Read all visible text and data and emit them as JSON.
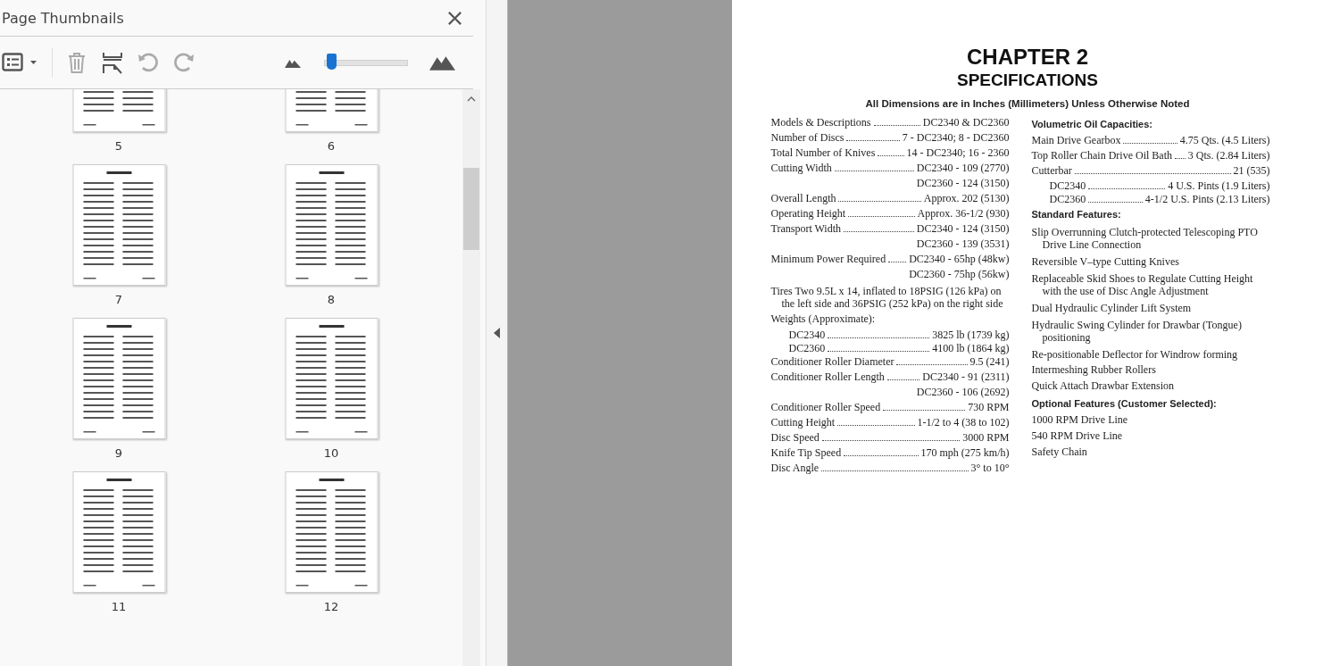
{
  "panel": {
    "title": "Page Thumbnails",
    "zoom_slider": {
      "level": 0.05
    }
  },
  "thumbnails": [
    {
      "label": "5"
    },
    {
      "label": "6"
    },
    {
      "label": "7"
    },
    {
      "label": "8"
    },
    {
      "label": "9"
    },
    {
      "label": "10"
    },
    {
      "label": "11"
    },
    {
      "label": "12"
    }
  ],
  "document": {
    "chapter": "CHAPTER 2",
    "title": "SPECIFICATIONS",
    "subtitle": "All Dimensions are in Inches (Millimeters) Unless Otherwise Noted",
    "left_column": [
      {
        "kind": "leader",
        "label": "Models & Descriptions",
        "value": "DC2340 & DC2360"
      },
      {
        "kind": "leader",
        "label": "Number of Discs",
        "value": "7 - DC2340; 8 - DC2360"
      },
      {
        "kind": "leader",
        "label": "Total Number of Knives",
        "value": "14 - DC2340; 16 - 2360"
      },
      {
        "kind": "leader",
        "label": "Cutting Width",
        "value": "DC2340 - 109 (2770)"
      },
      {
        "kind": "cont",
        "value": "DC2360 - 124 (3150)"
      },
      {
        "kind": "leader",
        "label": "Overall Length",
        "value": "Approx. 202 (5130)"
      },
      {
        "kind": "leader",
        "label": "Operating Height",
        "value": "Approx. 36-1/2 (930)"
      },
      {
        "kind": "leader",
        "label": "Transport Width",
        "value": "DC2340 - 124 (3150)"
      },
      {
        "kind": "cont",
        "value": "DC2360 - 139 (3531)"
      },
      {
        "kind": "leader",
        "label": "Minimum Power Required",
        "value": "DC2340 - 65hp (48kw)"
      },
      {
        "kind": "cont",
        "value": "DC2360 - 75hp (56kw)"
      },
      {
        "kind": "para",
        "text": "Tires  Two 9.5L x 14, inflated to 18PSIG (126 kPa) on the left side and 36PSIG (252 kPa) on the right side"
      },
      {
        "kind": "plain",
        "text": "Weights (Approximate):"
      },
      {
        "kind": "sub",
        "label": "DC2340",
        "value": "3825 lb (1739 kg)"
      },
      {
        "kind": "sub",
        "label": "DC2360",
        "value": "4100 lb (1864 kg)"
      },
      {
        "kind": "leader",
        "label": "Conditioner Roller Diameter",
        "value": "9.5 (241)"
      },
      {
        "kind": "leader",
        "label": "Conditioner Roller Length",
        "value": "DC2340 - 91 (2311)"
      },
      {
        "kind": "cont",
        "value": "DC2360 - 106 (2692)"
      },
      {
        "kind": "leader",
        "label": "Conditioner Roller Speed",
        "value": "730 RPM"
      },
      {
        "kind": "leader",
        "label": "Cutting Height",
        "value": "1-1/2 to 4 (38 to 102)"
      },
      {
        "kind": "leader",
        "label": "Disc Speed",
        "value": "3000 RPM"
      },
      {
        "kind": "leader",
        "label": "Knife Tip Speed",
        "value": "170 mph (275 km/h)"
      },
      {
        "kind": "leader",
        "label": "Disc Angle",
        "value": "3° to 10°"
      }
    ],
    "right_column": [
      {
        "kind": "heading",
        "text": "Volumetric Oil Capacities:"
      },
      {
        "kind": "leader",
        "label": "Main Drive Gearbox",
        "value": "4.75 Qts. (4.5 Liters)"
      },
      {
        "kind": "leader",
        "label": "Top Roller Chain Drive Oil Bath",
        "value": "3 Qts. (2.84 Liters)"
      },
      {
        "kind": "leader",
        "label": "Cutterbar",
        "value": "21 (535)"
      },
      {
        "kind": "sub",
        "label": "DC2340",
        "value": "4 U.S. Pints (1.9 Liters)"
      },
      {
        "kind": "sub",
        "label": "DC2360",
        "value": "4-1/2 U.S. Pints (2.13 Liters)"
      },
      {
        "kind": "heading",
        "text": "Standard Features:"
      },
      {
        "kind": "para",
        "text": "Slip Overrunning Clutch-protected Telescoping PTO Drive Line Connection"
      },
      {
        "kind": "para",
        "text": "Reversible V–type Cutting Knives"
      },
      {
        "kind": "para",
        "text": "Replaceable Skid Shoes to Regulate Cutting Height with the use of Disc Angle Adjustment"
      },
      {
        "kind": "para",
        "text": "Dual Hydraulic Cylinder Lift System"
      },
      {
        "kind": "para",
        "text": "Hydraulic Swing Cylinder for Drawbar (Tongue) positioning"
      },
      {
        "kind": "para",
        "text": "Re-positionable Deflector for Windrow forming"
      },
      {
        "kind": "plain",
        "text": "Intermeshing Rubber Rollers"
      },
      {
        "kind": "plain",
        "text": "Quick Attach Drawbar Extension"
      },
      {
        "kind": "heading",
        "text": "Optional Features (Customer Selected):"
      },
      {
        "kind": "plain",
        "text": "1000 RPM Drive Line"
      },
      {
        "kind": "plain",
        "text": "540 RPM Drive Line"
      },
      {
        "kind": "plain",
        "text": "Safety Chain"
      }
    ]
  }
}
